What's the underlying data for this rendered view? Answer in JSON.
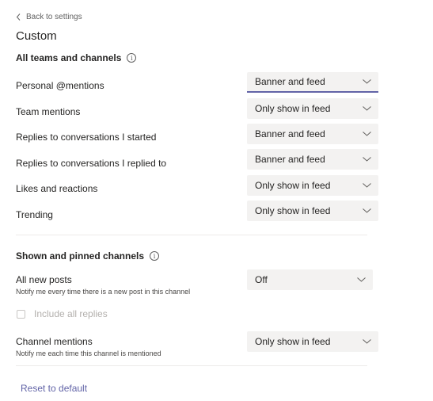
{
  "back_link": "Back to settings",
  "page_title": "Custom",
  "sections": [
    {
      "title": "All teams and channels",
      "info_icon": "info-icon",
      "rows": [
        {
          "label": "Personal @mentions",
          "value": "Banner and feed",
          "focused": true
        },
        {
          "label": "Team mentions",
          "value": "Only show in feed"
        },
        {
          "label": "Replies to conversations I started",
          "value": "Banner and feed"
        },
        {
          "label": "Replies to conversations I replied to",
          "value": "Banner and feed"
        },
        {
          "label": "Likes and reactions",
          "value": "Only show in feed"
        },
        {
          "label": "Trending",
          "value": "Only show in feed"
        }
      ]
    },
    {
      "title": "Shown and pinned channels",
      "info_icon": "info-icon",
      "rows": [
        {
          "label": "All new posts",
          "sublabel": "Notify me every time there is a new post in this channel",
          "value": "Off"
        },
        {
          "label": "Channel mentions",
          "sublabel": "Notify me each time this channel is mentioned",
          "value": "Only show in feed"
        }
      ],
      "checkbox": {
        "label": "Include all replies",
        "checked": false,
        "disabled": true
      }
    }
  ],
  "reset_link": "Reset to default",
  "colors": {
    "accent": "#6264a7",
    "dropdown_bg": "#f3f2f1",
    "text": "#252423"
  }
}
